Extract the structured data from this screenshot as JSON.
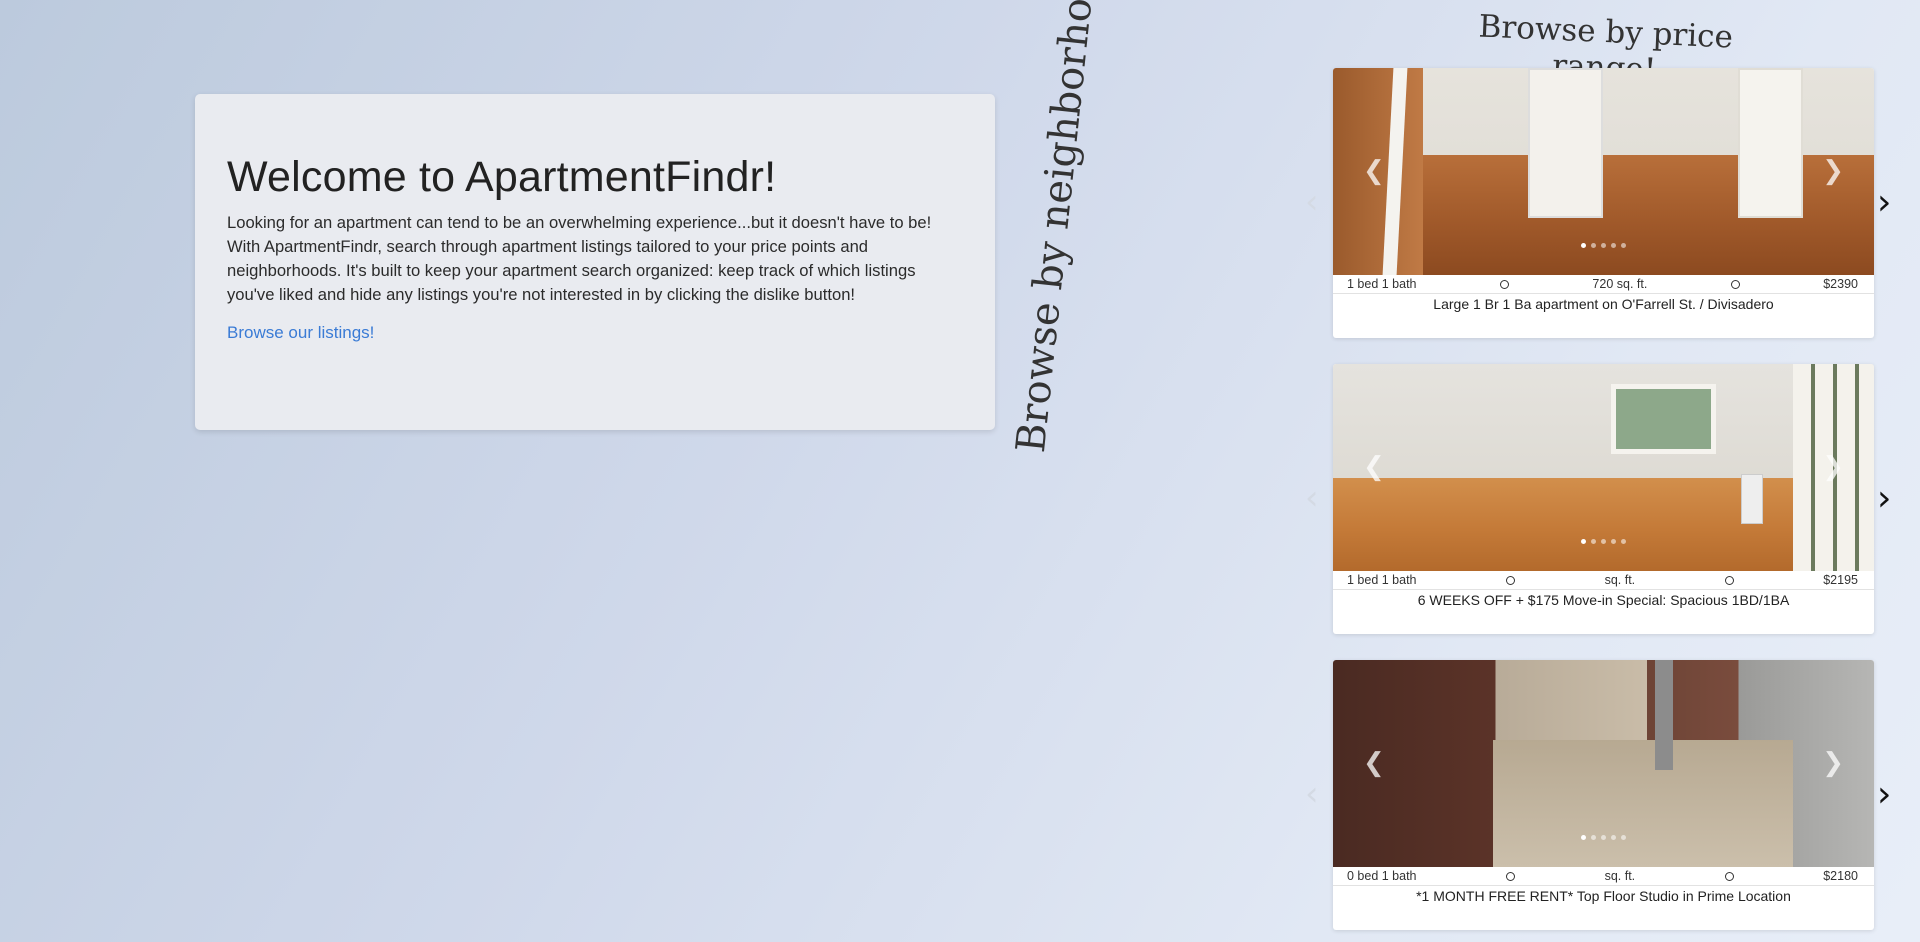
{
  "welcome": {
    "title": "Welcome to ApartmentFindr!",
    "description": "Looking for an apartment can tend to be an overwhelming experience...but it doesn't have to be! With ApartmentFindr, search through apartment listings tailored to your price points and neighborhoods. It's built to keep your apartment search organized: keep track of which listings you've liked and hide any listings you're not interested in by clicking the dislike button!",
    "link": "Browse our listings!"
  },
  "headings": {
    "price": "Browse by price range!",
    "neighborhood": "Browse by neighborhood!"
  },
  "icons": {
    "prev": "chevron-left-icon",
    "next": "chevron-right-icon",
    "circle": "circle-icon"
  },
  "listings": [
    {
      "beds": "1 bed 1 bath",
      "sqft": "720 sq. ft.",
      "price": "$2390",
      "title": "Large 1 Br 1 Ba apartment on O'Farrell St. / Divisadero",
      "photos": 5,
      "active_photo": 1
    },
    {
      "beds": "1 bed 1 bath",
      "sqft": "sq. ft.",
      "price": "$2195",
      "title": "6 WEEKS OFF + $175 Move-in Special: Spacious 1BD/1BA",
      "photos": 5,
      "active_photo": 1
    },
    {
      "beds": "0 bed 1 bath",
      "sqft": "sq. ft.",
      "price": "$2180",
      "title": "*1 MONTH FREE RENT* Top Floor Studio in Prime Location",
      "photos": 5,
      "active_photo": 1
    }
  ]
}
